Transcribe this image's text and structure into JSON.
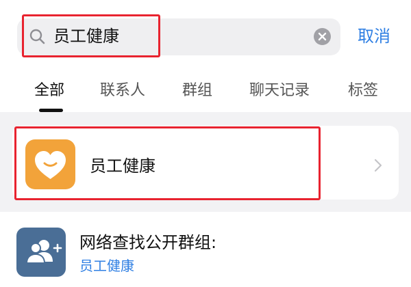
{
  "search": {
    "query": "员工健康",
    "cancel_label": "取消",
    "icon": "search-icon",
    "clear_icon": "clear-icon"
  },
  "tabs": [
    {
      "label": "全部",
      "active": true
    },
    {
      "label": "联系人",
      "active": false
    },
    {
      "label": "群组",
      "active": false
    },
    {
      "label": "聊天记录",
      "active": false
    },
    {
      "label": "标签",
      "active": false
    }
  ],
  "result": {
    "app_name": "员工健康",
    "icon": "heart-smile-icon",
    "icon_color": "#f2a33a",
    "chevron": "chevron-right-icon"
  },
  "public_group": {
    "title": "网络查找公开群组:",
    "query": "员工健康",
    "icon": "add-group-icon",
    "icon_color": "#4a6e96"
  },
  "colors": {
    "accent": "#2f7fe3",
    "highlight": "#e8232f"
  }
}
